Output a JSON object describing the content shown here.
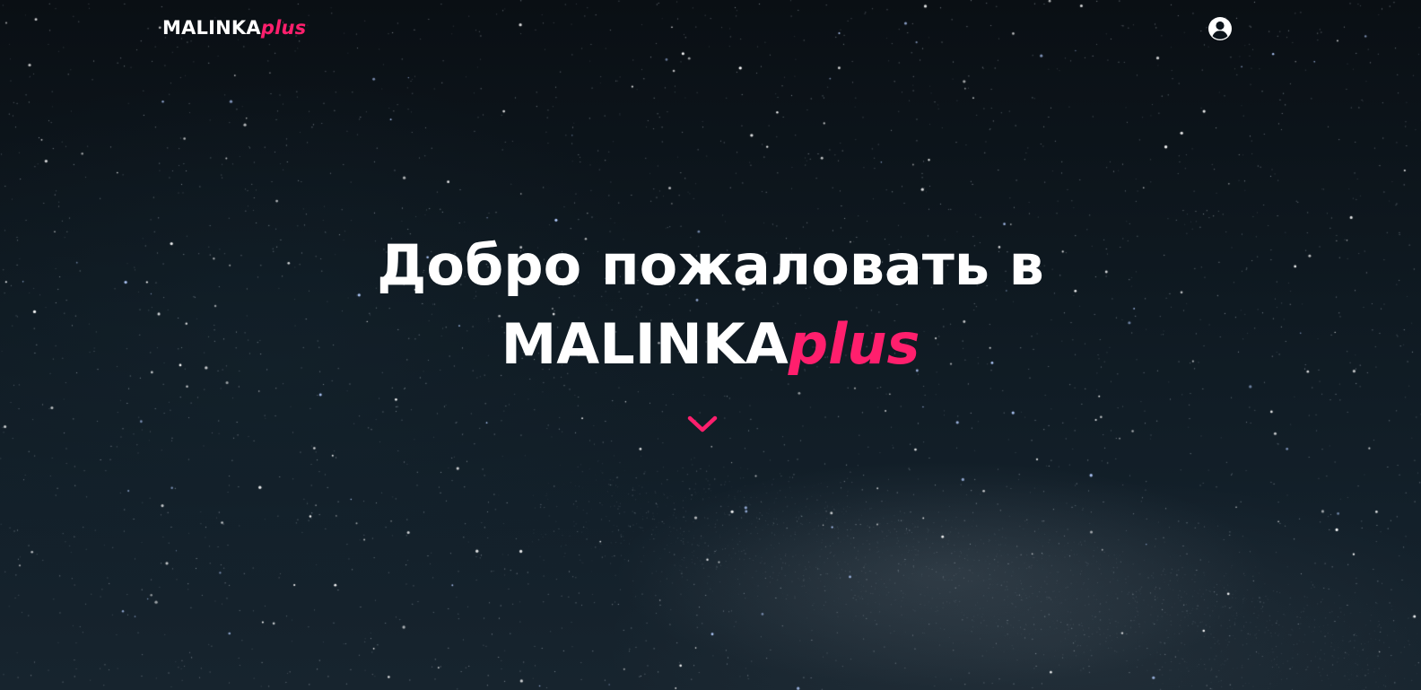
{
  "brand": {
    "name_main": "MALINKA",
    "name_accent": "plus",
    "accent_color": "#ff1f6d"
  },
  "header": {
    "account_icon": "user-circle-icon"
  },
  "hero": {
    "title_line1": "Добро пожаловать в",
    "title_brand_main": "MALINKA",
    "title_brand_accent": "plus",
    "scroll_icon": "chevron-down-icon",
    "background": "starry-night-sky"
  }
}
